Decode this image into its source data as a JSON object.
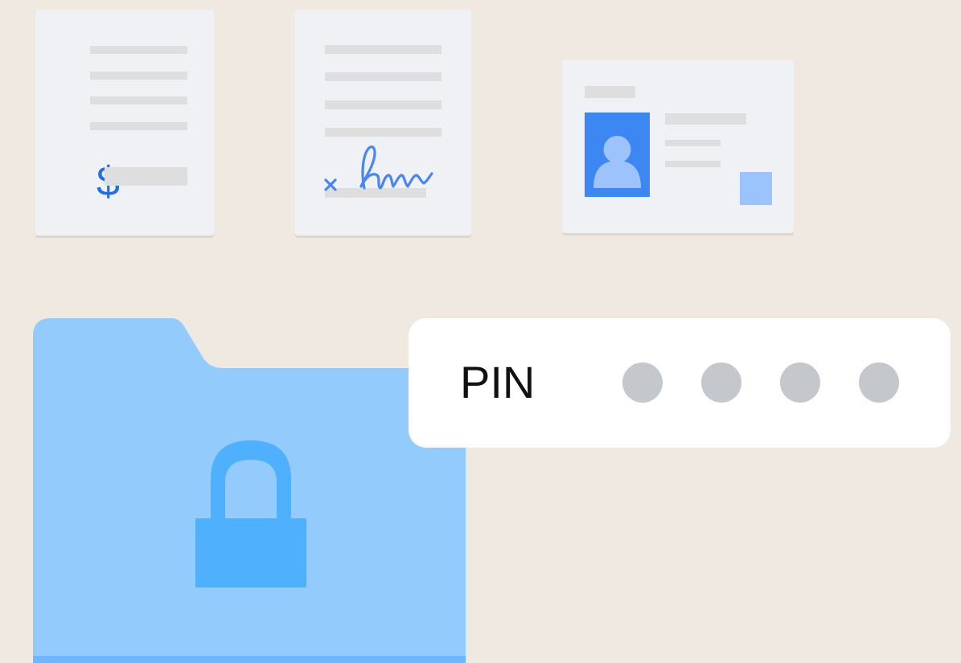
{
  "background_color": "#F0E9E2",
  "invoice_card": {
    "symbol": "$",
    "symbol_color": "#1F6FE8",
    "icon": "dollar-icon"
  },
  "contract_card": {
    "icon": "signature-icon",
    "signature_color": "#4A86EE"
  },
  "id_card": {
    "icon": "person-icon",
    "photo_color": "#3D87F2",
    "stamp_color": "#9BC3FC"
  },
  "secure_folder": {
    "icon": "lock-icon",
    "folder_color": "#93CBFC",
    "lock_color": "#4FB0FD"
  },
  "pin_prompt": {
    "label": "PIN",
    "digit_count": 4,
    "digits_entered": 0,
    "dot_color": "#C4C7CC"
  }
}
